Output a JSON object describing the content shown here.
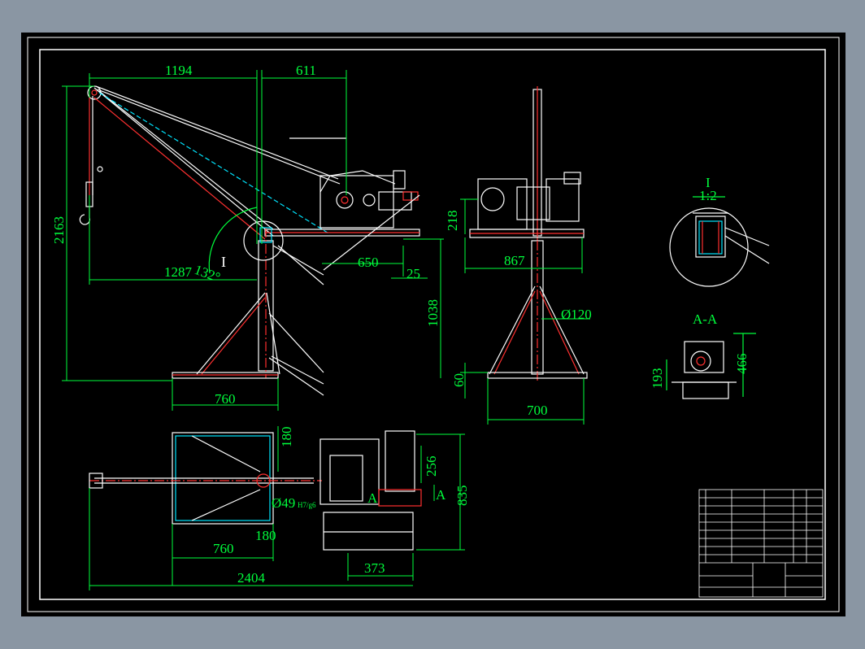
{
  "drawing": {
    "dimensions": {
      "d1194": "1194",
      "d611": "611",
      "d2163": "2163",
      "d1287": "1287",
      "d132": "132°",
      "d650": "650",
      "d25": "25",
      "d1038": "1038",
      "d760_top": "760",
      "d218": "218",
      "d867": "867",
      "d120": "Ø120",
      "d60": "60",
      "d700": "700",
      "d193": "193",
      "d466": "466",
      "d180_top": "180",
      "d256": "256",
      "d835": "835",
      "d49": "Ø49",
      "d49_fit": "H7/g6",
      "d180_bot": "180",
      "d760_bot": "760",
      "d373": "373",
      "d2404": "2404"
    },
    "labels": {
      "detail_ref": "I",
      "detail_title": "I",
      "detail_scale": "1:2",
      "section_title": "A-A",
      "section_mark_left": "A",
      "section_mark_right": "A"
    }
  },
  "colors": {
    "frame": "#ffffff",
    "dimension": "#00ff3c",
    "centerline": "#ff2020",
    "hidden": "#00e5ff",
    "yellow": "#ffff00"
  }
}
